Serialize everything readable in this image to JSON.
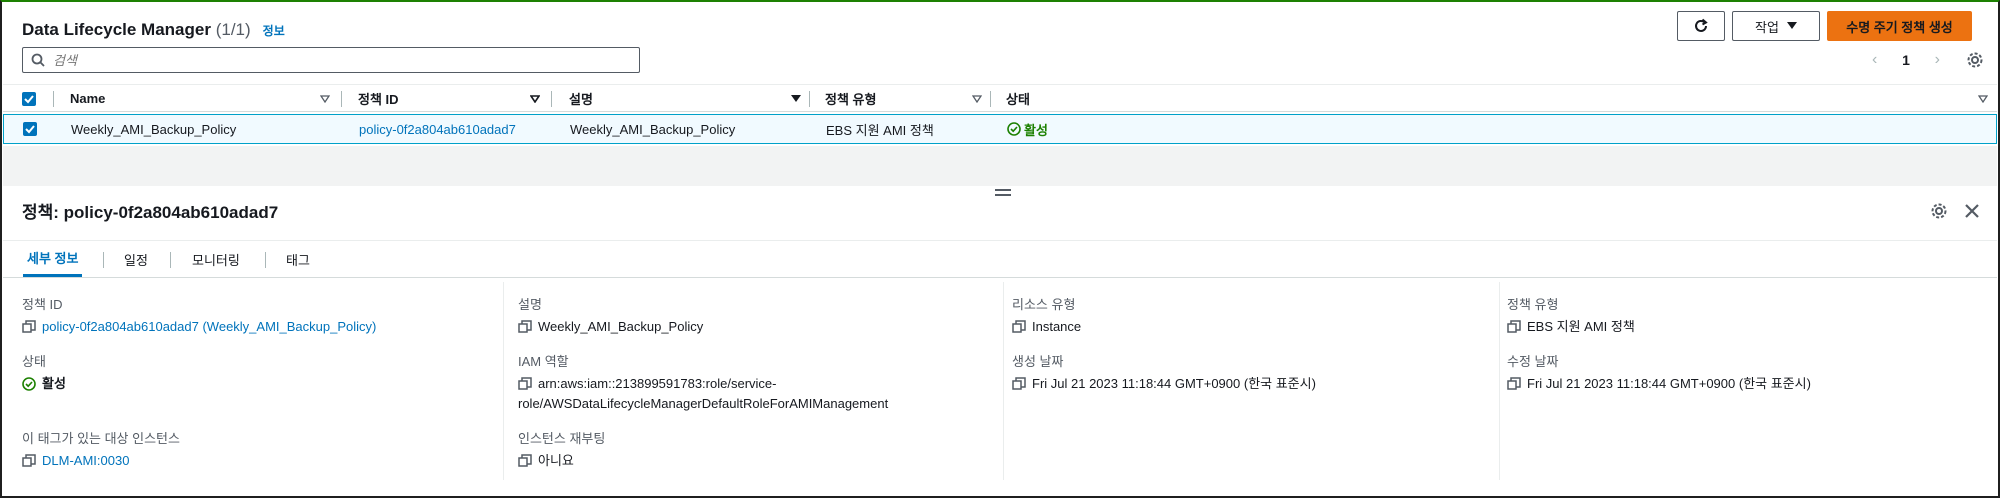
{
  "header": {
    "title": "Data Lifecycle Manager",
    "count": "(1/1)",
    "info_link": "정보",
    "actions_label": "작업",
    "create_label": "수명 주기 정책 생성",
    "search_placeholder": "검색",
    "current_page": "1"
  },
  "table": {
    "columns": [
      "Name",
      "정책 ID",
      "설명",
      "정책 유형",
      "상태"
    ],
    "rows": [
      {
        "name": "Weekly_AMI_Backup_Policy",
        "policy_id": "policy-0f2a804ab610adad7",
        "description": "Weekly_AMI_Backup_Policy",
        "policy_type": "EBS 지원 AMI 정책",
        "status": "활성"
      }
    ]
  },
  "detail": {
    "title": "정책: policy-0f2a804ab610adad7",
    "tabs": [
      "세부 정보",
      "일정",
      "모니터링",
      "태그"
    ],
    "fields": {
      "policy_id_label": "정책 ID",
      "policy_id_value": "policy-0f2a804ab610adad7 (Weekly_AMI_Backup_Policy)",
      "status_label": "상태",
      "status_value": "활성",
      "target_tag_label": "이 태그가 있는 대상 인스턴스",
      "target_tag_value": "DLM-AMI:0030",
      "description_label": "설명",
      "description_value": "Weekly_AMI_Backup_Policy",
      "iam_role_label": "IAM 역할",
      "iam_role_value_line1": "arn:aws:iam::213899591783:role/service-",
      "iam_role_value_line2": "role/AWSDataLifecycleManagerDefaultRoleForAMIManagement",
      "reboot_label": "인스턴스 재부팅",
      "reboot_value": "아니요",
      "resource_type_label": "리소스 유형",
      "resource_type_value": "Instance",
      "created_label": "생성 날짜",
      "created_value": "Fri Jul 21 2023 11:18:44 GMT+0900 (한국 표준시)",
      "policy_type_label": "정책 유형",
      "policy_type_value": "EBS 지원 AMI 정책",
      "modified_label": "수정 날짜",
      "modified_value": "Fri Jul 21 2023 11:18:44 GMT+0900 (한국 표준시)"
    }
  },
  "icons": {
    "refresh": "refresh-icon",
    "search": "search-icon",
    "settings": "gear-icon",
    "close": "close-icon",
    "copy": "copy-icon",
    "status": "check-circle-icon"
  },
  "colors": {
    "primary_button": "#ec7211",
    "link": "#0073bb",
    "success": "#1d8102",
    "selected_row_bg": "#f1faff"
  }
}
